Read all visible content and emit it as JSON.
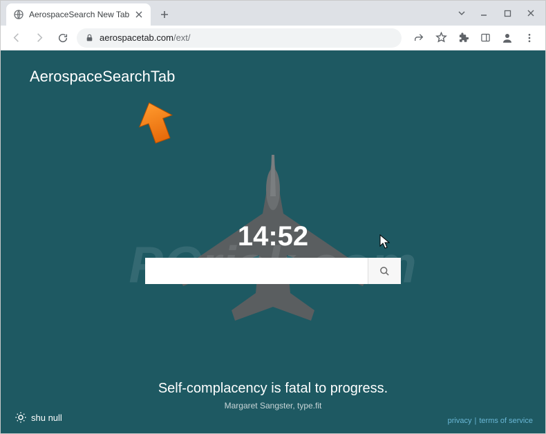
{
  "browser": {
    "tab_title": "AerospaceSearch New Tab",
    "url_domain": "aerospacetab.com",
    "url_path": "/ext/"
  },
  "page": {
    "logo": "AerospaceSearchTab",
    "clock": "14:52",
    "search_placeholder": "",
    "quote_text": "Self-complacency is fatal to progress.",
    "quote_author": "Margaret Sangster, type.fit",
    "weather_text": "shu null"
  },
  "footer": {
    "privacy": "privacy",
    "terms": "terms of service"
  },
  "watermark": "PCrisk.com"
}
